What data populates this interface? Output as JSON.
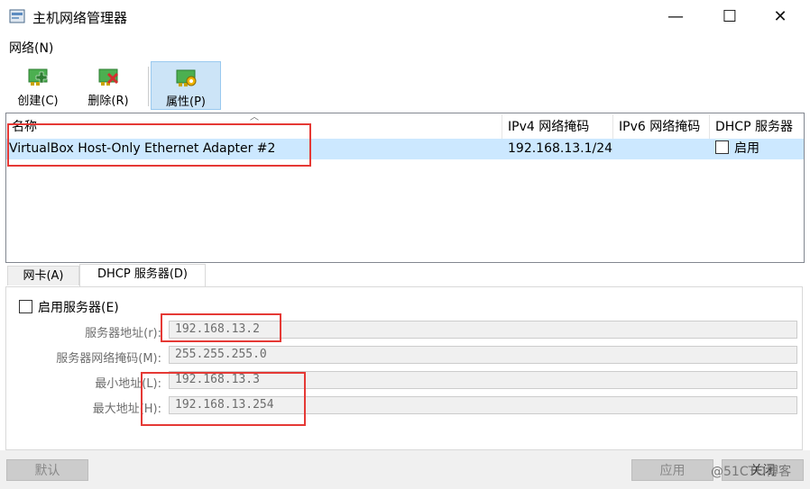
{
  "window": {
    "title": "主机网络管理器",
    "minimize_glyph": "—",
    "maximize_glyph": "☐",
    "close_glyph": "✕"
  },
  "menu": {
    "network": "网络(N)"
  },
  "toolbar": {
    "create_label": "创建(C)",
    "delete_label": "删除(R)",
    "properties_label": "属性(P)"
  },
  "list": {
    "columns": [
      "名称",
      "IPv4 网络掩码",
      "IPv6 网络掩码",
      "DHCP 服务器"
    ],
    "rows": [
      {
        "name": "VirtualBox Host-Only Ethernet Adapter #2",
        "ipv4": "192.168.13.1/24",
        "ipv6": "",
        "dhcp_label": "启用"
      }
    ]
  },
  "tabs": [
    "网卡(A)",
    "DHCP 服务器(D)"
  ],
  "dhcp": {
    "enable_label": "启用服务器(E)",
    "server_addr_label": "服务器地址(r):",
    "server_addr_value": "192.168.13.2",
    "server_mask_label": "服务器网络掩码(M):",
    "server_mask_value": "255.255.255.0",
    "min_addr_label": "最小地址(L):",
    "min_addr_value": "192.168.13.3",
    "max_addr_label": "最大地址(H):",
    "max_addr_value": "192.168.13.254"
  },
  "buttons": {
    "reset_label": "默认",
    "apply_label": "应用",
    "close_label": "关闭"
  },
  "watermark": "@51CTO博客",
  "colors": {
    "selection": "#cce8ff",
    "highlight_box": "#e53935",
    "toolbar_active": "#cce4f7"
  },
  "icons": [
    "app-icon",
    "network-card-add-icon",
    "network-card-delete-icon",
    "network-card-properties-icon",
    "sort-up-icon"
  ]
}
